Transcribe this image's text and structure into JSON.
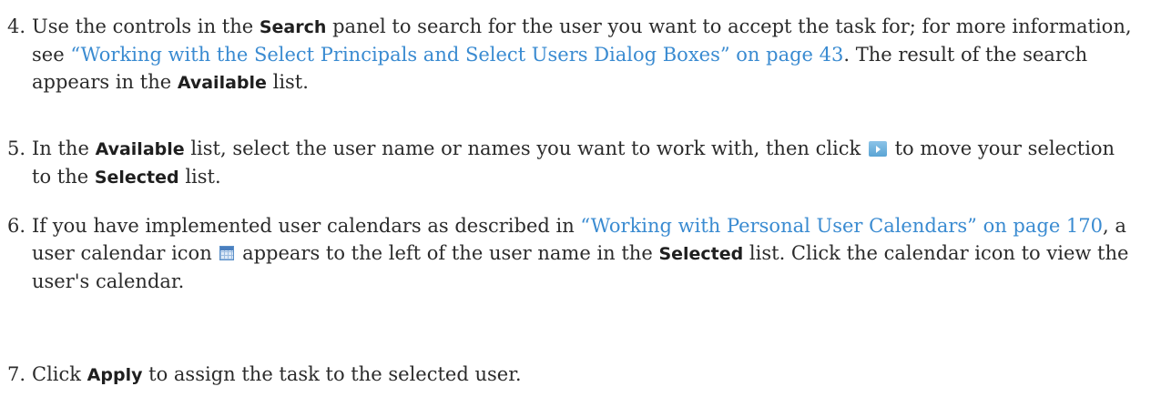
{
  "steps": [
    {
      "number": "4.",
      "t1": "Use the controls in the ",
      "b1": "Search",
      "t2": " panel to search for the user you want to accept the task for; for more information, see ",
      "link": "“Working with the Select Principals and Select Users Dialog Boxes” on page 43",
      "t3": ". The result of the search appears in the ",
      "b2": "Available",
      "t4": " list."
    },
    {
      "number": "5.",
      "t1": "In the ",
      "b1": "Available",
      "t2": " list, select the user name or names you want to work with, then click ",
      "icon": "move-right-arrow-icon",
      "t3": " to move your selection to the ",
      "b2": "Selected",
      "t4": " list."
    },
    {
      "number": "6.",
      "t1": "If you have implemented user calendars as described in ",
      "link": "“Working with Personal User Calendars” on page 170",
      "t2": ", a user calendar icon ",
      "icon": "calendar-icon",
      "t3": " appears to the left of the user name in the ",
      "b1": "Selected",
      "t4": " list. Click the calendar icon to view the user's calendar."
    },
    {
      "number": "7.",
      "t1": "Click ",
      "b1": "Apply",
      "t2": " to assign the task to the selected user."
    }
  ],
  "colors": {
    "text": "#2b2b2b",
    "link": "#3a8bd1",
    "icon_accent": "#5aa4d4"
  }
}
